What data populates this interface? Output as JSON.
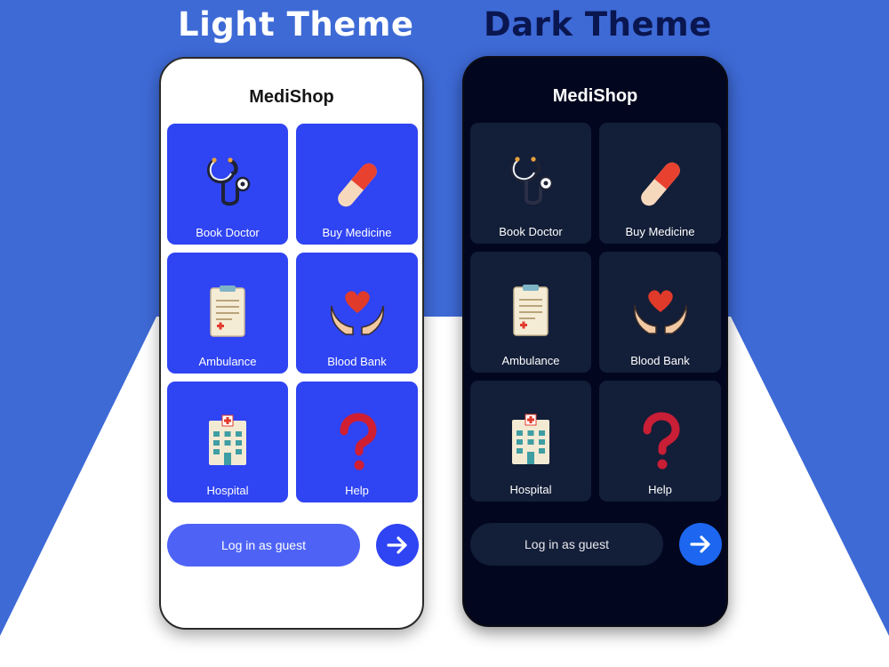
{
  "headings": {
    "light": "Light Theme",
    "dark": "Dark Theme"
  },
  "colors": {
    "background_blue": "#3e6ad6",
    "light_tile": "#2f44f2",
    "dark_screen": "#02071f",
    "dark_tile": "#131e38",
    "dark_go_button": "#1c66f0"
  },
  "app": {
    "title": "MediShop",
    "tiles": [
      {
        "label": "Book Doctor",
        "icon": "stethoscope-icon"
      },
      {
        "label": "Buy Medicine",
        "icon": "pill-icon"
      },
      {
        "label": "Ambulance",
        "icon": "clipboard-icon"
      },
      {
        "label": "Blood Bank",
        "icon": "heart-hands-icon"
      },
      {
        "label": "Hospital",
        "icon": "hospital-icon"
      },
      {
        "label": "Help",
        "icon": "question-mark-icon"
      }
    ],
    "guest_button": "Log in as guest",
    "go_button_icon": "arrow-right-icon"
  }
}
